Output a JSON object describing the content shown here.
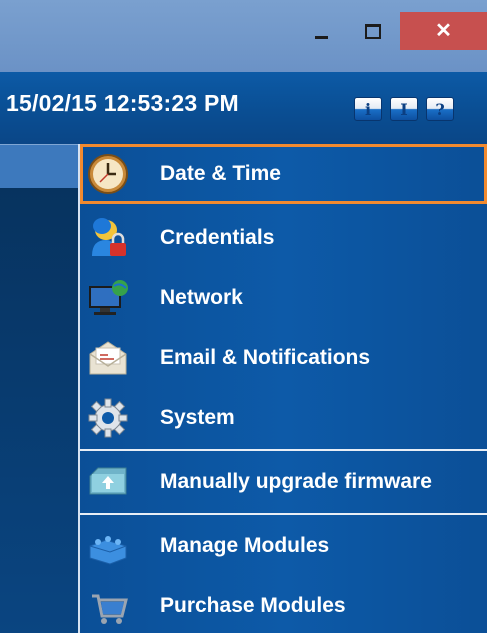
{
  "window": {
    "min_label": "",
    "close_glyph": "✕"
  },
  "header": {
    "datetime": "15/02/15 12:53:23 PM",
    "icons": [
      {
        "name": "info-icon",
        "glyph": "i"
      },
      {
        "name": "tools-icon",
        "glyph": "I"
      },
      {
        "name": "help-icon",
        "glyph": "?"
      }
    ]
  },
  "menu": {
    "items": [
      {
        "label": "Date & Time",
        "icon": "clock-icon",
        "selected": true
      },
      {
        "label": "Credentials",
        "icon": "users-lock-icon"
      },
      {
        "label": "Network",
        "icon": "monitor-globe-icon"
      },
      {
        "label": "Email & Notifications",
        "icon": "envelope-icon"
      },
      {
        "label": "System",
        "icon": "gear-icon"
      },
      {
        "label": "Manually upgrade firmware",
        "icon": "upload-icon"
      },
      {
        "label": "Manage Modules",
        "icon": "modules-icon"
      },
      {
        "label": "Purchase Modules",
        "icon": "cart-icon"
      }
    ]
  },
  "colors": {
    "accent_selection": "#f28a2f",
    "menu_bg": "#0d5aa8",
    "close_button": "#c7504f"
  }
}
